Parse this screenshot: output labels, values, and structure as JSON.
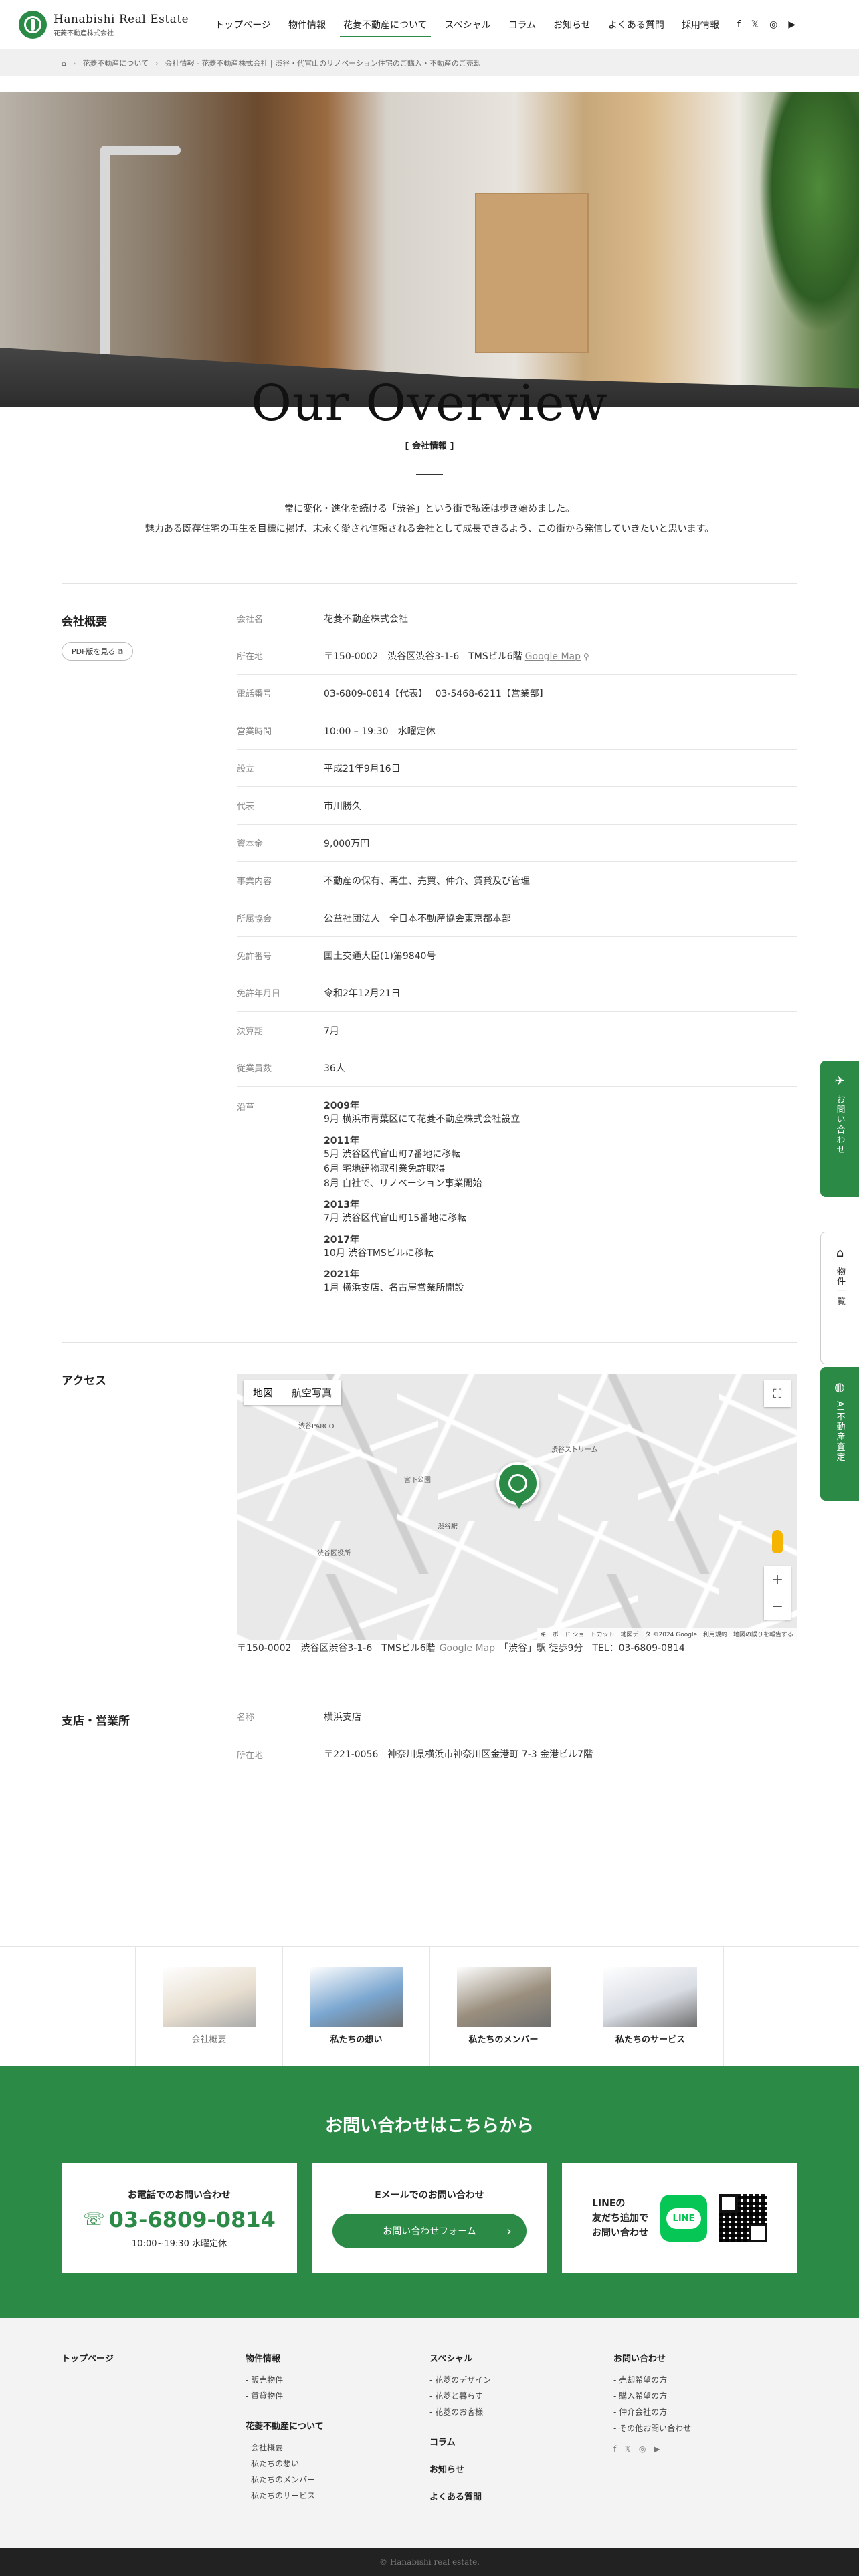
{
  "header": {
    "logo_en": "Hanabishi Real Estate",
    "logo_jp": "花菱不動産株式会社",
    "nav": [
      "トップページ",
      "物件情報",
      "花菱不動産について",
      "スペシャル",
      "コラム",
      "お知らせ",
      "よくある質問",
      "採用情報"
    ],
    "sns": [
      "f",
      "𝕏",
      "◎",
      "▶"
    ]
  },
  "breadcrumb": [
    "花菱不動産について",
    "会社情報 - 花菱不動産株式会社 | 渋谷・代官山のリノベーション住宅のご購入・不動産のご売却"
  ],
  "overview": {
    "title": "Our Overview",
    "subtitle": "[ 会社情報 ]",
    "lead1": "常に変化・進化を続ける「渋谷」という街で私達は歩き始めました。",
    "lead2": "魅力ある既存住宅の再生を目標に掲げ、末永く愛され信頼される会社として成長できるよう、この街から発信していきたいと思います。"
  },
  "company": {
    "heading": "会社概要",
    "pdf_label": "PDF版を見る ⧉",
    "rows": [
      {
        "k": "会社名",
        "v": "花菱不動産株式会社"
      },
      {
        "k": "所在地",
        "v": "〒150-0002　渋谷区渋谷3-1-6　TMSビル6階",
        "link": "Google Map"
      },
      {
        "k": "電話番号",
        "v": "03-6809-0814【代表】　 03-5468-6211【営業部】"
      },
      {
        "k": "営業時間",
        "v": "10:00 – 19:30　水曜定休"
      },
      {
        "k": "設立",
        "v": "平成21年9月16日"
      },
      {
        "k": "代表",
        "v": "市川勝久"
      },
      {
        "k": "資本金",
        "v": "9,000万円"
      },
      {
        "k": "事業内容",
        "v": "不動産の保有、再生、売買、仲介、賃貸及び管理"
      },
      {
        "k": "所属協会",
        "v": "公益社団法人　全日本不動産協会東京都本部"
      },
      {
        "k": "免許番号",
        "v": "国土交通大臣(1)第9840号"
      },
      {
        "k": "免許年月日",
        "v": "令和2年12月21日"
      },
      {
        "k": "決算期",
        "v": "7月"
      },
      {
        "k": "従業員数",
        "v": "36人"
      }
    ],
    "history_label": "沿革",
    "history": [
      {
        "year": "2009年",
        "items": [
          "9月 横浜市青葉区にて花菱不動産株式会社設立"
        ]
      },
      {
        "year": "2011年",
        "items": [
          "5月 渋谷区代官山町7番地に移転",
          "6月 宅地建物取引業免許取得",
          "8月 自社で、リノベーション事業開始"
        ]
      },
      {
        "year": "2013年",
        "items": [
          "7月 渋谷区代官山町15番地に移転"
        ]
      },
      {
        "year": "2017年",
        "items": [
          "10月 渋谷TMSビルに移転"
        ]
      },
      {
        "year": "2021年",
        "items": [
          "1月 横浜支店、名古屋営業所開設"
        ]
      }
    ]
  },
  "access": {
    "heading": "アクセス",
    "map_tab_map": "地図",
    "map_tab_sat": "航空写真",
    "map_attr": "キーボード ショートカット　地図データ ©2024 Google　利用規約　地図の誤りを報告する",
    "map_labels": [
      "渋谷PARCO",
      "渋谷ストリーム",
      "渋谷駅",
      "宮下公園",
      "渋谷区役所"
    ],
    "caption_addr": "〒150-0002　渋谷区渋谷3-1-6　TMSビル6階",
    "caption_link": "Google Map",
    "caption_rest": "「渋谷」駅 徒歩9分　TEL：03-6809-0814"
  },
  "branch": {
    "heading": "支店・営業所",
    "rows": [
      {
        "k": "名称",
        "v": "横浜支店"
      },
      {
        "k": "所在地",
        "v": "〒221-0056　神奈川県横浜市神奈川区金港町 7-3 金港ビル7階"
      }
    ]
  },
  "subnav": [
    {
      "label": "会社概要",
      "color": "#d8c9b0"
    },
    {
      "label": "私たちの想い",
      "color": "#7aa6d0"
    },
    {
      "label": "私たちのメンバー",
      "color": "#9a8f7e"
    },
    {
      "label": "私たちのサービス",
      "color": "#d9dde4"
    }
  ],
  "contact": {
    "heading": "お問い合わせはこちらから",
    "tel_title": "お電話でのお問い合わせ",
    "tel": "03-6809-0814",
    "hours": "10:00~19:30 水曜定休",
    "mail_title": "Eメールでのお問い合わせ",
    "form_label": "お問い合わせフォーム",
    "line_text": [
      "LINEの",
      "友だち追加で",
      "お問い合わせ"
    ],
    "line_logo": "LINE"
  },
  "footer": {
    "col1": {
      "heading": "トップページ"
    },
    "col2": {
      "heading": "物件情報",
      "links": [
        "販売物件",
        "賃貸物件"
      ],
      "heading2": "花菱不動産について",
      "links2": [
        "会社概要",
        "私たちの想い",
        "私たちのメンバー",
        "私たちのサービス"
      ]
    },
    "col3": {
      "heading": "スペシャル",
      "links": [
        "花菱のデザイン",
        "花菱と暮らす",
        "花菱のお客様"
      ],
      "h_column": "コラム",
      "h_news": "お知らせ",
      "h_faq": "よくある質問"
    },
    "col4": {
      "heading": "お問い合わせ",
      "links": [
        "売却希望の方",
        "購入希望の方",
        "仲介会社の方",
        "その他お問い合わせ"
      ],
      "sns": [
        "f",
        "𝕏",
        "◎",
        "▶"
      ]
    },
    "copyright": "© Hanabishi real estate."
  },
  "side": {
    "contact": "お問い合わせ",
    "list": "物件一覧",
    "ai": "AI不動産査定",
    "contact_icon": "✈",
    "list_icon": "⌂",
    "ai_icon": "◍"
  }
}
